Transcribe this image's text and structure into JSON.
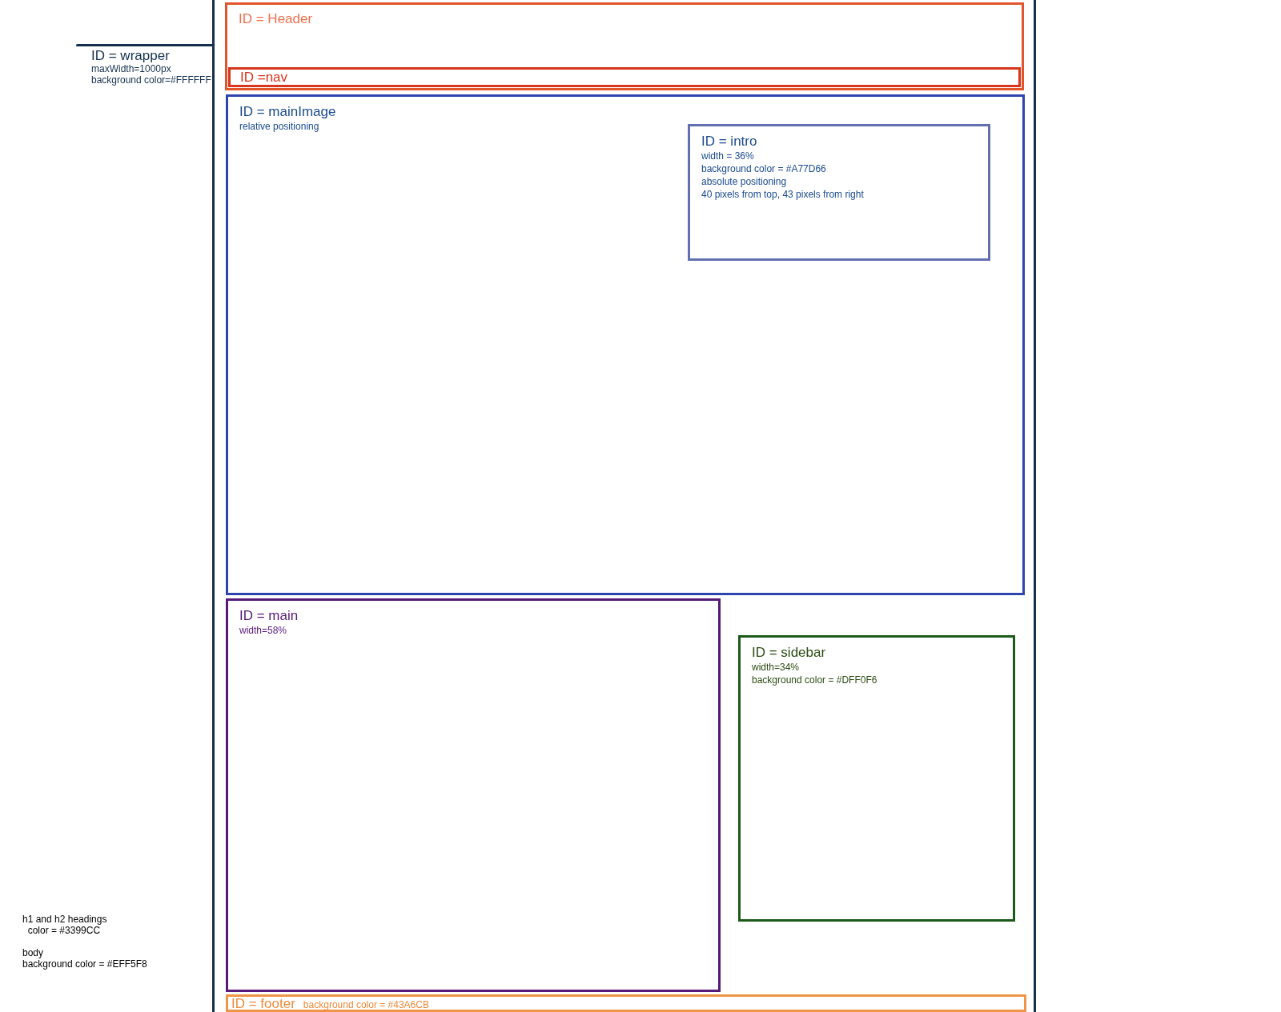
{
  "wrapper": {
    "title": "ID = wrapper",
    "notes": [
      "maxWidth=1000px",
      "background color=#FFFFFF"
    ]
  },
  "boxes": [
    {
      "title": "ID = Header",
      "color": "#e2552a"
    },
    {
      "title": "ID =nav",
      "color": "#d9341c"
    },
    {
      "title": "ID = mainImage",
      "notes": [
        "relative positioning"
      ],
      "color": "#2e45b0"
    },
    {
      "title": "ID = intro",
      "notes": [
        "width = 36%",
        "background color = #A77D66",
        "absolute positioning",
        "40 pixels from top, 43 pixels from right"
      ],
      "color": "#6270b2"
    },
    {
      "title": "ID = main",
      "notes": [
        "width=58%"
      ],
      "color": "#561a78"
    },
    {
      "title": "ID = sidebar",
      "notes": [
        "width=34%",
        "background color = #DFF0F6"
      ],
      "color": "#1c5a1a"
    },
    {
      "title": "ID = footer",
      "notes": [
        "background color = #43A6CB"
      ],
      "color": "#ef9548"
    }
  ],
  "legend": [
    [
      "h1 and h2 headings",
      "  color = #3399CC"
    ],
    [
      "body",
      "background color = #EFF5F8"
    ]
  ]
}
